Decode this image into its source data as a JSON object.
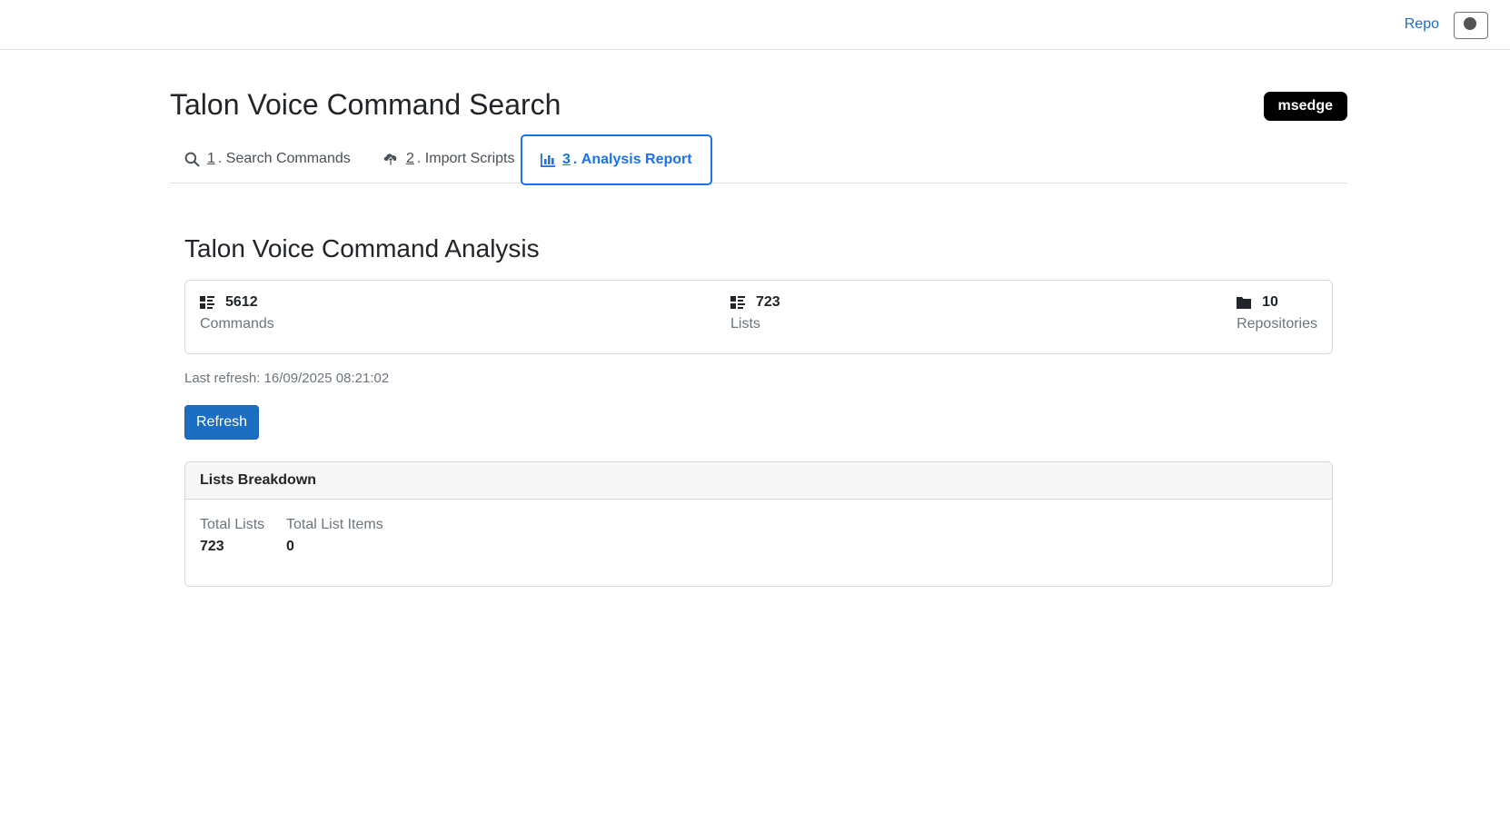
{
  "topbar": {
    "repo_link": "Repo"
  },
  "header": {
    "title": "Talon Voice Command Search",
    "browser_badge": "msedge"
  },
  "tabs": [
    {
      "number": "1",
      "label": "Search Commands",
      "icon": "search-icon",
      "active": false
    },
    {
      "number": "2",
      "label": "Import Scripts",
      "icon": "cloud-upload-icon",
      "active": false
    },
    {
      "number": "3",
      "label": "Analysis Report",
      "icon": "bar-chart-icon",
      "active": true
    }
  ],
  "analysis": {
    "title": "Talon Voice Command Analysis",
    "stats": [
      {
        "value": "5612",
        "label": "Commands",
        "icon": "list-icon"
      },
      {
        "value": "723",
        "label": "Lists",
        "icon": "list-icon"
      },
      {
        "value": "10",
        "label": "Repositories",
        "icon": "folder-icon"
      }
    ],
    "last_refresh": "Last refresh: 16/09/2025 08:21:02",
    "refresh_button": "Refresh",
    "breakdown": {
      "title": "Lists Breakdown",
      "total_lists_label": "Total Lists",
      "total_lists_value": "723",
      "total_items_label": "Total List Items",
      "total_items_value": "0"
    }
  },
  "colors": {
    "accent": "#1a73e8",
    "button": "#1b6ec2",
    "badge": "#000000"
  }
}
